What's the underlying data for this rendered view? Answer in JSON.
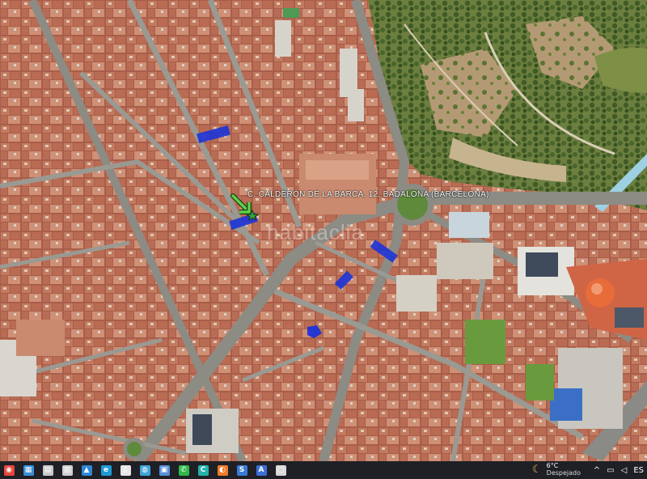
{
  "map": {
    "place_label": "C. CALDERÓN DE LA BARCA, 12, BADALONA (BARCELONA)",
    "watermark": "habitaclia",
    "colors": {
      "roof": "#b2634d",
      "roof_light": "#cf8f73",
      "street": "#9a9a92",
      "avenue": "#7f7e78",
      "park": "#5f7a3a",
      "tree": "#3e5a26",
      "dirt": "#b9a27e",
      "highlight": "#1c34d8",
      "dome": "#e86b3a",
      "marker": "#5fd04a"
    },
    "marker_icon": "arrow-marker-icon"
  },
  "taskbar": {
    "icons": [
      {
        "name": "chrome-icon",
        "glyph": "◉",
        "color": "#e8453c"
      },
      {
        "name": "app-icon",
        "glyph": "▦",
        "color": "#3a8fd6"
      },
      {
        "name": "file-explorer-icon",
        "glyph": "▤",
        "color": "#c9c9c9"
      },
      {
        "name": "calendar-icon",
        "glyph": "▥",
        "color": "#d0d0d0"
      },
      {
        "name": "photos-icon",
        "glyph": "▲",
        "color": "#2f86d8"
      },
      {
        "name": "edge-icon",
        "glyph": "e",
        "color": "#1f9ad6"
      },
      {
        "name": "document-icon",
        "glyph": "▯",
        "color": "#e6e6e6"
      },
      {
        "name": "globe-icon",
        "glyph": "◍",
        "color": "#3fa4d8"
      },
      {
        "name": "save-icon",
        "glyph": "▣",
        "color": "#5a8fd6"
      },
      {
        "name": "whatsapp-icon",
        "glyph": "✆",
        "color": "#2fb84a"
      },
      {
        "name": "c-app-icon",
        "glyph": "C",
        "color": "#24b3a8"
      },
      {
        "name": "firefox-icon",
        "glyph": "◐",
        "color": "#f07a2a"
      },
      {
        "name": "s-app-icon",
        "glyph": "S",
        "color": "#3a7bd6"
      },
      {
        "name": "a-app-icon",
        "glyph": "A",
        "color": "#3a6fd6"
      },
      {
        "name": "window-app-icon",
        "glyph": "▢",
        "color": "#d8d8d8"
      }
    ],
    "weather": {
      "temperature": "6°C",
      "condition": "Despejado",
      "icon": "moon-icon"
    },
    "tray": {
      "chevron": "^",
      "network": "▭",
      "volume": "◁",
      "lang": "ES"
    }
  }
}
